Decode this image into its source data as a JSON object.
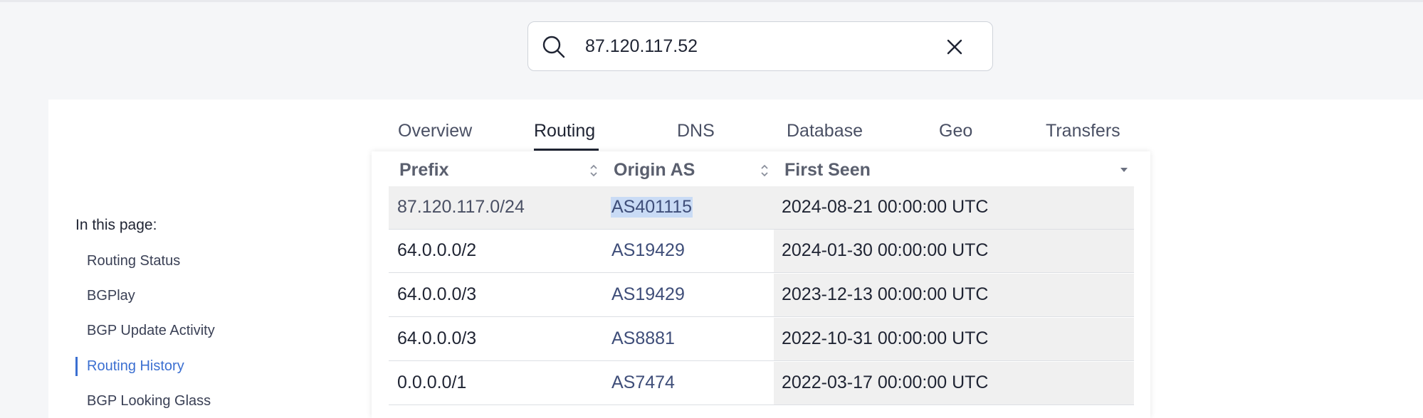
{
  "search": {
    "value": "87.120.117.52",
    "icon": "search-icon",
    "clear_icon": "close-icon"
  },
  "tabs": [
    {
      "label": "Overview",
      "active": false
    },
    {
      "label": "Routing",
      "active": true
    },
    {
      "label": "DNS",
      "active": false
    },
    {
      "label": "Database",
      "active": false
    },
    {
      "label": "Geo",
      "active": false
    },
    {
      "label": "Transfers",
      "active": false
    }
  ],
  "table": {
    "columns": [
      {
        "label": "Prefix",
        "sort": "sortable"
      },
      {
        "label": "Origin AS",
        "sort": "sortable"
      },
      {
        "label": "First Seen",
        "sort": "descending"
      }
    ],
    "rows": [
      {
        "prefix": "87.120.117.0/24",
        "origin_as": "AS401115",
        "first_seen": "2024-08-21 00:00:00 UTC"
      },
      {
        "prefix": "64.0.0.0/2",
        "origin_as": "AS19429",
        "first_seen": "2024-01-30 00:00:00 UTC"
      },
      {
        "prefix": "64.0.0.0/3",
        "origin_as": "AS19429",
        "first_seen": "2023-12-13 00:00:00 UTC"
      },
      {
        "prefix": "64.0.0.0/3",
        "origin_as": "AS8881",
        "first_seen": "2022-10-31 00:00:00 UTC"
      },
      {
        "prefix": "0.0.0.0/1",
        "origin_as": "AS7474",
        "first_seen": "2022-03-17 00:00:00 UTC"
      }
    ]
  },
  "toc": {
    "title": "In this page:",
    "items": [
      {
        "label": "Routing Status",
        "active": false
      },
      {
        "label": "BGPlay",
        "active": false
      },
      {
        "label": "BGP Update Activity",
        "active": false
      },
      {
        "label": "Routing History",
        "active": true
      },
      {
        "label": "BGP Looking Glass",
        "active": false
      }
    ]
  },
  "colors": {
    "accent": "#3b6fd1",
    "link": "#3f4e79",
    "selection": "#c9dbf5"
  }
}
